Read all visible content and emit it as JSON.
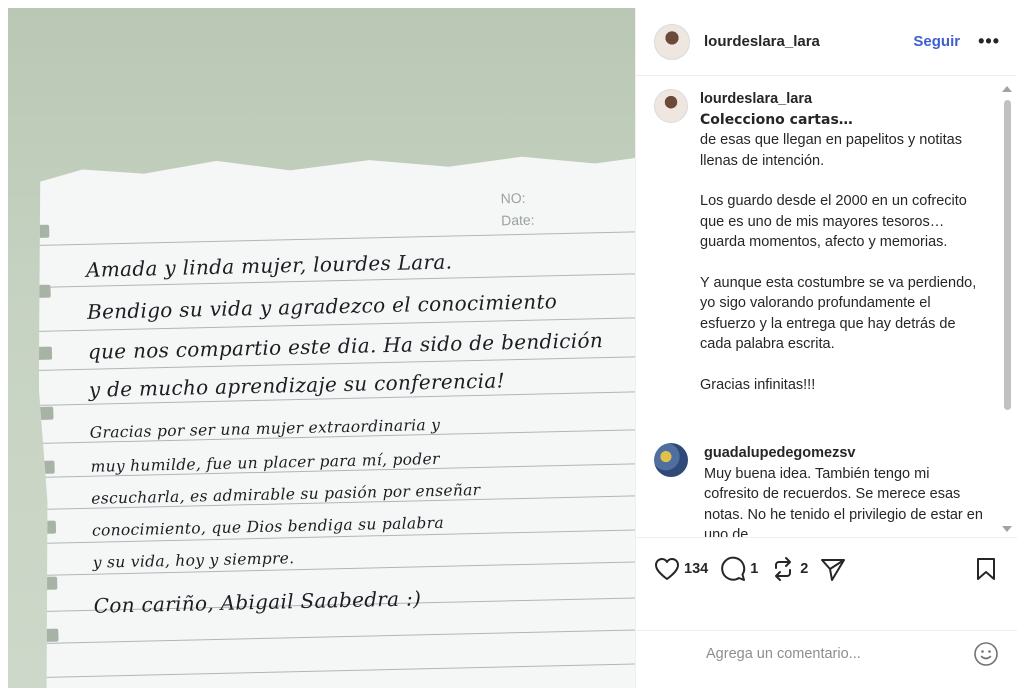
{
  "post": {
    "author": "lourdeslara_lara",
    "follow_label": "Seguir",
    "more_label": "•••"
  },
  "photo": {
    "note_header_no": "NO:",
    "note_header_date": "Date:",
    "handwriting": [
      "Amada y linda mujer, lourdes Lara.",
      "Bendigo su vida y agradezco el conocimiento",
      "que nos compartio este dia. Ha sido de bendición",
      "y de mucho aprendizaje su conferencia!",
      "Gracias por ser una mujer extraordinaria y",
      "muy humilde, fue un placer para mí, poder",
      "escucharla, es admirable su pasión por enseñar",
      "conocimiento, que Dios bendiga su palabra",
      "y su vida, hoy y siempre.",
      "Con cariño, Abigail Saabedra :)"
    ]
  },
  "caption": {
    "username": "lourdeslara_lara",
    "headline": "Colecciono cartas…",
    "paragraphs": [
      "de esas que llegan en papelitos y notitas llenas de intención.",
      "Los guardo desde el 2000 en un cofrecito que es uno de mis mayores tesoros… guarda momentos, afecto y memorias.",
      "Y aunque esta costumbre se va perdiendo, yo sigo valorando profundamente el esfuerzo y la entrega que hay detrás de cada palabra escrita.",
      "Gracias infinitas!!!"
    ]
  },
  "comment": {
    "username": "guadalupedegomezsv",
    "text": "Muy buena idea. También tengo mi cofresito de recuerdos. Se merece esas notas. No he tenido el privilegio de estar en uno de"
  },
  "actions": {
    "likes": "134",
    "comments": "1",
    "reposts": "2"
  },
  "add_comment": {
    "placeholder": "Agrega un comentario..."
  }
}
